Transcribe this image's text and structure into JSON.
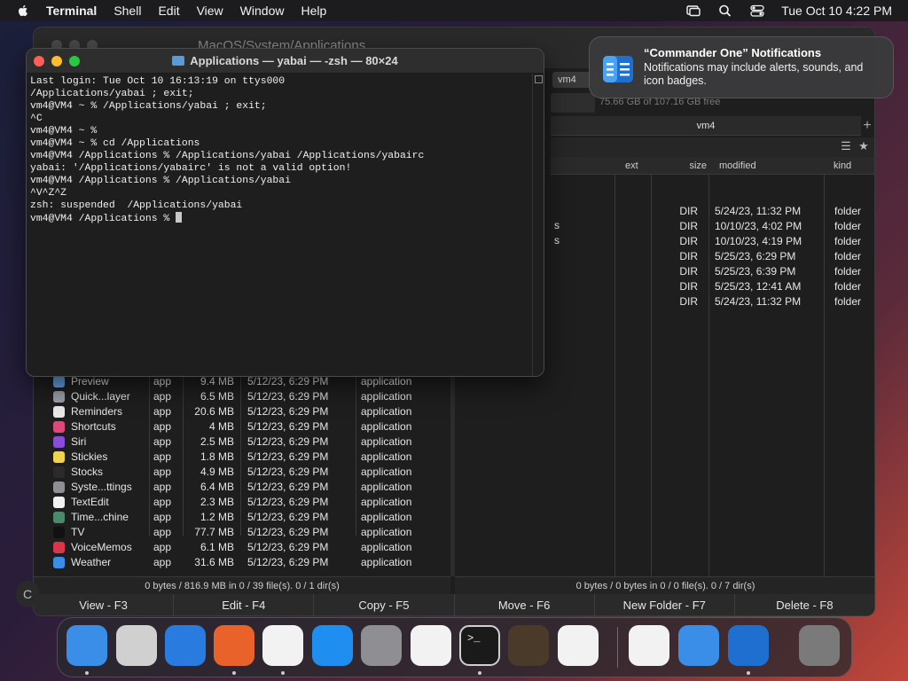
{
  "menubar": {
    "app_name": "Terminal",
    "items": [
      "Shell",
      "Edit",
      "View",
      "Window",
      "Help"
    ],
    "clock": "Tue Oct 10  4:22 PM"
  },
  "commander": {
    "path_title": "MacOS/System/Applications",
    "right_tab_short": "vm4",
    "right_tab": "vm4",
    "disk_info": "75.66 GB of 107.16 GB free",
    "plus": "+",
    "right_headers": {
      "ext": "ext",
      "size": "size",
      "modified": "modified",
      "kind": "kind"
    },
    "right_rows": [
      {
        "size": "DIR",
        "modified": "5/24/23, 11:32 PM",
        "kind": "folder"
      },
      {
        "size": "DIR",
        "modified": "10/10/23, 4:02 PM",
        "kind": "folder"
      },
      {
        "size": "DIR",
        "modified": "10/10/23, 4:19 PM",
        "kind": "folder"
      },
      {
        "size": "DIR",
        "modified": "5/25/23, 6:29 PM",
        "kind": "folder"
      },
      {
        "size": "DIR",
        "modified": "5/25/23, 6:39 PM",
        "kind": "folder"
      },
      {
        "size": "DIR",
        "modified": "5/25/23, 12:41 AM",
        "kind": "folder"
      },
      {
        "size": "DIR",
        "modified": "5/24/23, 11:32 PM",
        "kind": "folder"
      }
    ],
    "right_partial": [
      "s",
      "s"
    ],
    "left_rows": [
      {
        "name": "Preview",
        "ext": "app",
        "size": "9.4 MB",
        "modified": "5/12/23, 6:29 PM",
        "kind": "application",
        "color": "#6aa7e8"
      },
      {
        "name": "Quick...layer",
        "ext": "app",
        "size": "6.5 MB",
        "modified": "5/12/23, 6:29 PM",
        "kind": "application",
        "color": "#9aa0a6"
      },
      {
        "name": "Reminders",
        "ext": "app",
        "size": "20.6 MB",
        "modified": "5/12/23, 6:29 PM",
        "kind": "application",
        "color": "#e8e8e8"
      },
      {
        "name": "Shortcuts",
        "ext": "app",
        "size": "4 MB",
        "modified": "5/12/23, 6:29 PM",
        "kind": "application",
        "color": "#e0457b"
      },
      {
        "name": "Siri",
        "ext": "app",
        "size": "2.5 MB",
        "modified": "5/12/23, 6:29 PM",
        "kind": "application",
        "color": "#8a4dd8"
      },
      {
        "name": "Stickies",
        "ext": "app",
        "size": "1.8 MB",
        "modified": "5/12/23, 6:29 PM",
        "kind": "application",
        "color": "#f2d24b"
      },
      {
        "name": "Stocks",
        "ext": "app",
        "size": "4.9 MB",
        "modified": "5/12/23, 6:29 PM",
        "kind": "application",
        "color": "#2b2b2b"
      },
      {
        "name": "Syste...ttings",
        "ext": "app",
        "size": "6.4 MB",
        "modified": "5/12/23, 6:29 PM",
        "kind": "application",
        "color": "#8e8e93"
      },
      {
        "name": "TextEdit",
        "ext": "app",
        "size": "2.3 MB",
        "modified": "5/12/23, 6:29 PM",
        "kind": "application",
        "color": "#f0f0f0"
      },
      {
        "name": "Time...chine",
        "ext": "app",
        "size": "1.2 MB",
        "modified": "5/12/23, 6:29 PM",
        "kind": "application",
        "color": "#4a8a6a"
      },
      {
        "name": "TV",
        "ext": "app",
        "size": "77.7 MB",
        "modified": "5/12/23, 6:29 PM",
        "kind": "application",
        "color": "#111111"
      },
      {
        "name": "VoiceMemos",
        "ext": "app",
        "size": "6.1 MB",
        "modified": "5/12/23, 6:29 PM",
        "kind": "application",
        "color": "#d9364b"
      },
      {
        "name": "Weather",
        "ext": "app",
        "size": "31.6 MB",
        "modified": "5/12/23, 6:29 PM",
        "kind": "application",
        "color": "#3a8ee8"
      }
    ],
    "status_left": "0 bytes / 816.9 MB in 0 / 39 file(s). 0 / 1 dir(s)",
    "status_right": "0 bytes / 0 bytes in 0 / 0 file(s). 0 / 7 dir(s)",
    "fn_buttons": [
      "View - F3",
      "Edit - F4",
      "Copy - F5",
      "Move - F6",
      "New Folder - F7",
      "Delete - F8"
    ]
  },
  "terminal": {
    "title": "Applications — yabai — -zsh — 80×24",
    "lines": [
      "Last login: Tue Oct 10 16:13:19 on ttys000",
      "/Applications/yabai ; exit;",
      "vm4@VM4 ~ % /Applications/yabai ; exit;",
      "^C",
      "vm4@VM4 ~ %",
      "vm4@VM4 ~ % cd /Applications",
      "vm4@VM4 /Applications % /Applications/yabai /Applications/yabairc",
      "yabai: '/Applications/yabairc' is not a valid option!",
      "vm4@VM4 /Applications % /Applications/yabai",
      "^V^Z^Z",
      "zsh: suspended  /Applications/yabai"
    ],
    "prompt": "vm4@VM4 /Applications % "
  },
  "notification": {
    "title": "“Commander One” Notifications",
    "body": "Notifications may include alerts, sounds, and icon badges."
  },
  "dock": {
    "items": [
      {
        "name": "finder",
        "color": "#3a8ee8"
      },
      {
        "name": "launchpad",
        "color": "#d0d0d0"
      },
      {
        "name": "safari",
        "color": "#2a7be0"
      },
      {
        "name": "firefox",
        "color": "#e8622a"
      },
      {
        "name": "chrome",
        "color": "#f2f2f2"
      },
      {
        "name": "app-store",
        "color": "#1e8ef0"
      },
      {
        "name": "system-settings",
        "color": "#8e8e93"
      },
      {
        "name": "textedit",
        "color": "#f2f2f2"
      },
      {
        "name": "terminal",
        "color": "#1a1a1a"
      },
      {
        "name": "garageband",
        "color": "#4a3a2a"
      },
      {
        "name": "vscode",
        "color": "#f2f2f2"
      },
      {
        "name": "visual-studio",
        "color": "#f2f2f2"
      },
      {
        "name": "weather-app",
        "color": "#3a8ee8"
      },
      {
        "name": "commander-one",
        "color": "#1e6fd0"
      },
      {
        "name": "trash",
        "color": "#7a7a7a"
      }
    ]
  }
}
